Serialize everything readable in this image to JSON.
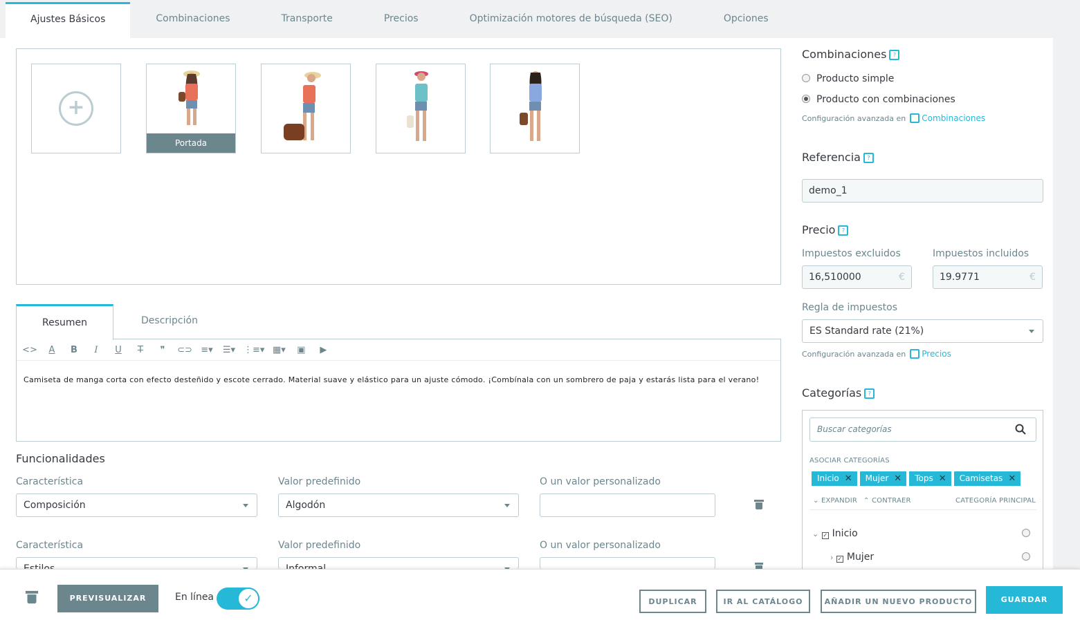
{
  "tabs": [
    "Ajustes Básicos",
    "Combinaciones",
    "Transporte",
    "Precios",
    "Optimización motores de búsqueda (SEO)",
    "Opciones"
  ],
  "images": {
    "cover_label": "Portada"
  },
  "summary_tabs": [
    "Resumen",
    "Descripción"
  ],
  "editor_text": "Camiseta de manga corta con efecto desteñido y escote cerrado. Material suave y elástico para un ajuste cómodo. ¡Combínala con un sombrero de paja y estarás lista para el verano!",
  "features": {
    "title": "Funcionalidades",
    "rows": [
      {
        "label_feature": "Característica",
        "feature": "Composición",
        "label_value": "Valor predefinido",
        "value": "Algodón",
        "label_custom": "O un valor personalizado",
        "custom": ""
      },
      {
        "label_feature": "Característica",
        "feature": "Estilos",
        "label_value": "Valor predefinido",
        "value": "Informal",
        "label_custom": "O un valor personalizado",
        "custom": ""
      }
    ]
  },
  "combinations": {
    "title": "Combinaciones",
    "option_simple": "Producto simple",
    "option_combos": "Producto con combinaciones",
    "cfg_text": "Configuración avanzada en",
    "cfg_link": "Combinaciones"
  },
  "reference": {
    "title": "Referencia",
    "value": "demo_1"
  },
  "price": {
    "title": "Precio",
    "label_excl": "Impuestos excluidos",
    "value_excl": "16,510000",
    "label_incl": "Impuestos incluidos",
    "value_incl": "19.9771",
    "currency": "€",
    "tax_label": "Regla de impuestos",
    "tax_value": "ES Standard rate (21%)",
    "cfg_text": "Configuración avanzada en",
    "cfg_link": "Precios"
  },
  "categories": {
    "title": "Categorías",
    "search_placeholder": "Buscar categorías",
    "associated_label": "ASOCIAR CATEGORÍAS",
    "tags": [
      "Inicio",
      "Mujer",
      "Tops",
      "Camisetas"
    ],
    "expand": "EXPANDIR",
    "collapse": "CONTRAER",
    "main_category": "CATEGORÍA PRINCIPAL",
    "tree": [
      "Inicio",
      "Mujer"
    ]
  },
  "footer": {
    "preview": "PREVISUALIZAR",
    "online": "En línea",
    "duplicate": "DUPLICAR",
    "catalog": "IR AL CATÁLOGO",
    "new_product": "AÑADIR UN NUEVO PRODUCTO",
    "save": "GUARDAR"
  },
  "colors": {
    "accent": "#25b9d7",
    "muted": "#6c868e",
    "border": "#bbcdd2"
  }
}
